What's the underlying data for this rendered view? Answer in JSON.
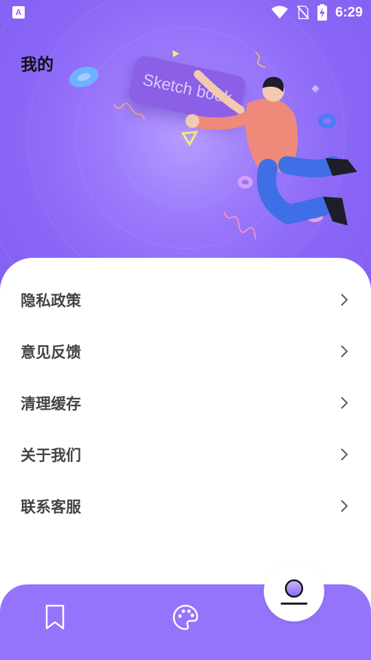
{
  "status_bar": {
    "app_icon": "A",
    "time": "6:29",
    "icons": [
      "wifi-icon",
      "no-sim-icon",
      "battery-charging-icon"
    ]
  },
  "header": {
    "title": "我的",
    "illustration_text": "Sketch book"
  },
  "menu": {
    "items": [
      {
        "label": "隐私政策"
      },
      {
        "label": "意见反馈"
      },
      {
        "label": "清理缓存"
      },
      {
        "label": "关于我们"
      },
      {
        "label": "联系客服"
      }
    ]
  },
  "tabbar": {
    "tabs": [
      {
        "icon": "bookmark-icon",
        "active": false
      },
      {
        "icon": "palette-icon",
        "active": false
      },
      {
        "icon": "profile-icon",
        "active": true
      }
    ]
  },
  "colors": {
    "primary": "#9474fa",
    "hero_bg": "#8a66f6",
    "text": "#444444"
  }
}
